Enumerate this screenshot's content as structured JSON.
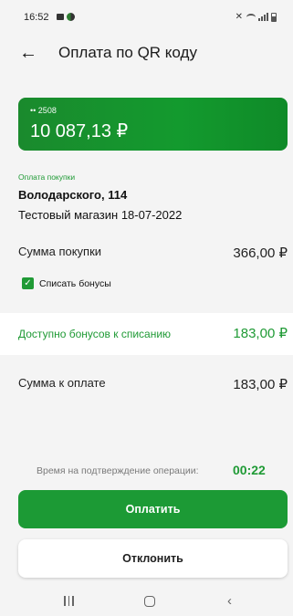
{
  "status_bar": {
    "time": "16:52"
  },
  "header": {
    "title": "Оплата по QR коду"
  },
  "card": {
    "number": "•• 2508",
    "balance": "10 087,13 ₽"
  },
  "purchase": {
    "section_label": "Оплата покупки",
    "merchant_name": "Володарского, 114",
    "store": "Тестовый магазин 18-07-2022",
    "amount_label": "Сумма покупки",
    "amount_value": "366,00 ₽"
  },
  "bonuses": {
    "checkbox_label": "Списать бонусы",
    "checked": true,
    "available_label": "Доступно бонусов к списанию",
    "available_value": "183,00 ₽"
  },
  "total": {
    "label": "Сумма к оплате",
    "value": "183,00 ₽"
  },
  "timer": {
    "label": "Время на подтверждение операции:",
    "value": "00:22"
  },
  "actions": {
    "pay_label": "Оплатить",
    "decline_label": "Отклонить"
  },
  "colors": {
    "accent": "#1c9a35",
    "background": "#f4f4f4"
  }
}
